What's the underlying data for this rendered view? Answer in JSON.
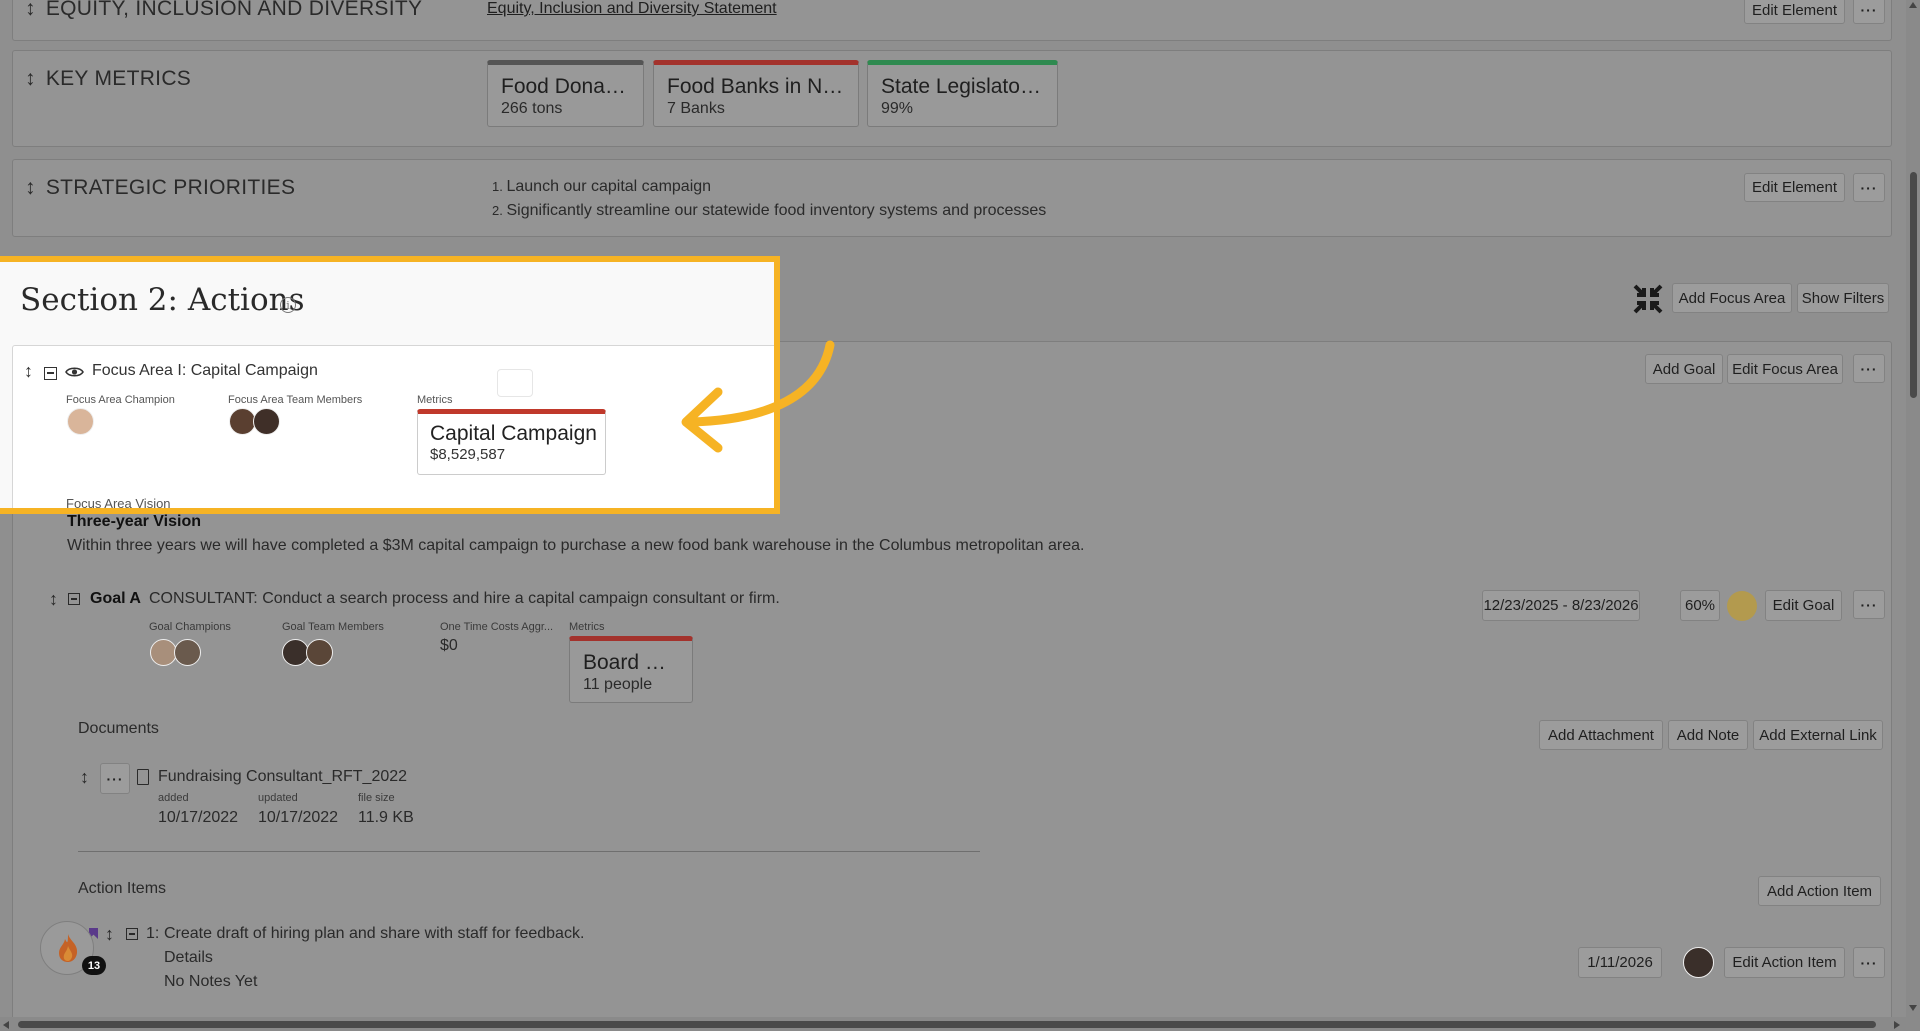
{
  "sections": {
    "equity": {
      "label": "EQUITY, INCLUSION AND DIVERSITY",
      "link": "Equity, Inclusion and Diversity Statement",
      "edit": "Edit Element"
    },
    "key_metrics": {
      "label": "KEY METRICS",
      "tiles": [
        {
          "title": "Food Donated",
          "value": "266 tons",
          "color": "#555555"
        },
        {
          "title": "Food Banks in Net...",
          "value": "7 Banks",
          "color": "#a3322c"
        },
        {
          "title": "State Legislators...",
          "value": "99%",
          "color": "#2f8a50"
        }
      ]
    },
    "strategic": {
      "label": "STRATEGIC PRIORITIES",
      "items": [
        "Launch our capital campaign",
        "Significantly streamline our statewide food inventory systems and processes"
      ],
      "edit": "Edit Element"
    }
  },
  "section2": {
    "title": "Section 2: Actions",
    "info_icon": "info-icon",
    "buttons": {
      "add_focus_area": "Add Focus Area",
      "show_filters": "Show Filters"
    }
  },
  "focus_area": {
    "title": "Focus Area I: Capital Campaign",
    "champion_label": "Focus Area Champion",
    "team_label": "Focus Area Team Members",
    "metrics_label": "Metrics",
    "metric": {
      "title": "Capital Campaign",
      "value": "$8,529,587",
      "color": "#a3322c"
    },
    "vision_label": "Focus Area Vision",
    "vision_title": "Three-year Vision",
    "vision_text": "Within three years we will have completed a $3M capital campaign to purchase a new food bank warehouse in the Columbus metropolitan area.",
    "buttons": {
      "add_goal": "Add Goal",
      "edit_focus_area": "Edit Focus Area"
    }
  },
  "goal": {
    "label": "Goal A",
    "text": "CONSULTANT: Conduct a search process and hire a capital campaign consultant or firm.",
    "dates": "12/23/2025 - 8/23/2026",
    "progress": "60%",
    "status_color": "#b39a4e",
    "edit": "Edit Goal",
    "champions_label": "Goal Champions",
    "team_label": "Goal Team Members",
    "costs_label": "One Time Costs Aggr...",
    "costs_value": "$0",
    "metrics_label": "Metrics",
    "metric": {
      "title": "Board Size",
      "value": "11 people",
      "color": "#a3322c"
    }
  },
  "documents": {
    "label": "Documents",
    "buttons": {
      "add_attachment": "Add Attachment",
      "add_note": "Add Note",
      "add_external_link": "Add External Link"
    },
    "file": {
      "name": "Fundraising Consultant_RFT_2022",
      "added_label": "added",
      "added": "10/17/2022",
      "updated_label": "updated",
      "updated": "10/17/2022",
      "size_label": "file size",
      "size": "11.9 KB"
    }
  },
  "action_items": {
    "label": "Action Items",
    "add": "Add Action Item",
    "item": {
      "number": "1:",
      "text": "Create draft of hiring plan and share with staff for feedback.",
      "details": "Details",
      "notes": "No Notes Yet",
      "date": "1/11/2026",
      "edit": "Edit Action Item"
    }
  },
  "badge": {
    "count": "13"
  },
  "highlight_color": "#f6b324"
}
